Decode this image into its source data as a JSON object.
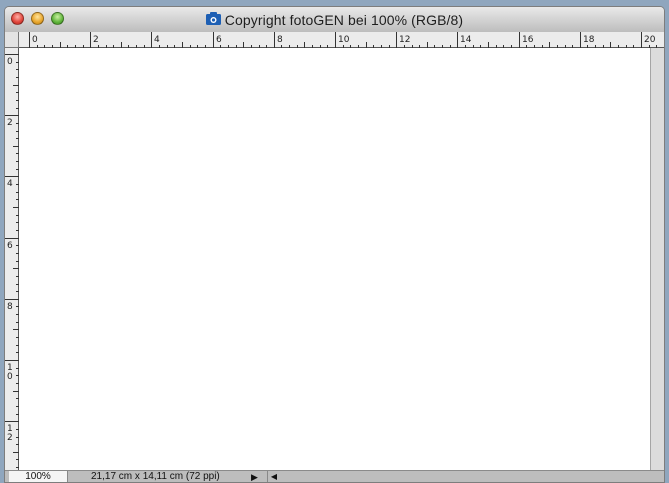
{
  "window": {
    "title": "Copyright fotoGEN bei 100% (RGB/8)",
    "icon": "photoshop-document-icon"
  },
  "ruler": {
    "horizontal_labels": [
      "0",
      "2",
      "4",
      "6",
      "8",
      "10",
      "12",
      "14",
      "16",
      "18",
      "20"
    ],
    "vertical_labels": [
      "0",
      "2",
      "4",
      "6",
      "8",
      "10",
      "12"
    ]
  },
  "status": {
    "zoom": "100%",
    "doc_info": "21,17 cm x 14,11 cm (72 ppi)",
    "menu_arrow": "▶",
    "scroll_left": "◀"
  },
  "colors": {
    "canvas": "#ffffff",
    "desktop": "#8fa6be"
  }
}
